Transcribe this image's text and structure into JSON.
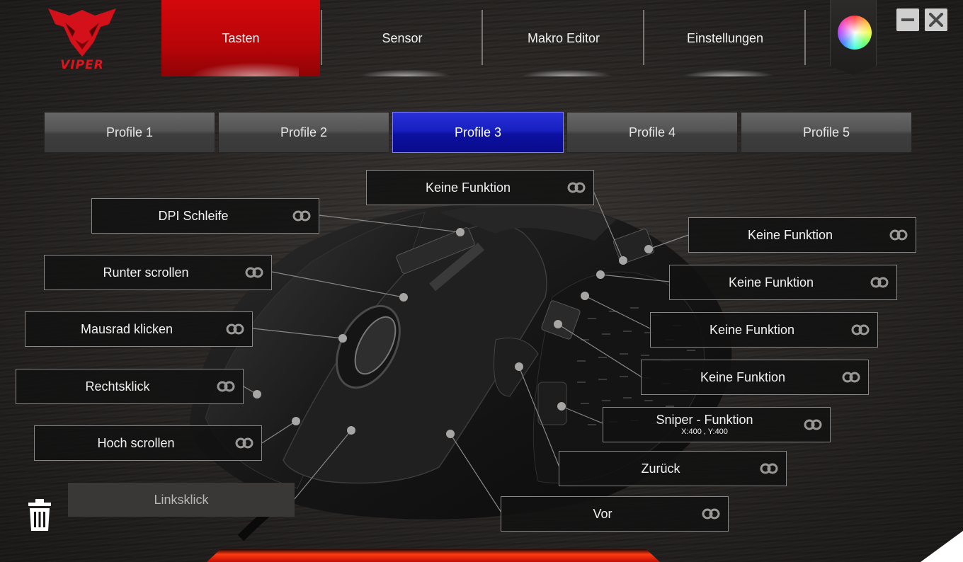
{
  "header": {
    "logo_text": "VIPER",
    "nav_tabs": [
      {
        "label": "Tasten",
        "active": true
      },
      {
        "label": "Sensor",
        "active": false
      },
      {
        "label": "Makro Editor",
        "active": false
      },
      {
        "label": "Einstellungen",
        "active": false
      }
    ],
    "icons": {
      "color": "color-wheel-icon",
      "minimize": "minimize-icon",
      "close": "close-icon"
    },
    "accent_color": "#c0070b"
  },
  "profiles": {
    "tabs": [
      "Profile 1",
      "Profile 2",
      "Profile 3",
      "Profile 4",
      "Profile 5"
    ],
    "active_index": 2,
    "active_color": "#1820c0"
  },
  "assignments": {
    "top": "Keine Funktion",
    "dpi": "DPI Schleife",
    "scroll_down": "Runter scrollen",
    "wheel_click": "Mausrad klicken",
    "right_click": "Rechtsklick",
    "scroll_up": "Hoch scrollen",
    "left_click": "Linksklick",
    "side1": "Keine Funktion",
    "side2": "Keine Funktion",
    "side3": "Keine Funktion",
    "side4": "Keine Funktion",
    "sniper": "Sniper - Funktion",
    "sniper_sub": "X:400 , Y:400",
    "back": "Zurück",
    "forward": "Vor"
  },
  "footer": {
    "trash_icon": "trash-icon"
  }
}
